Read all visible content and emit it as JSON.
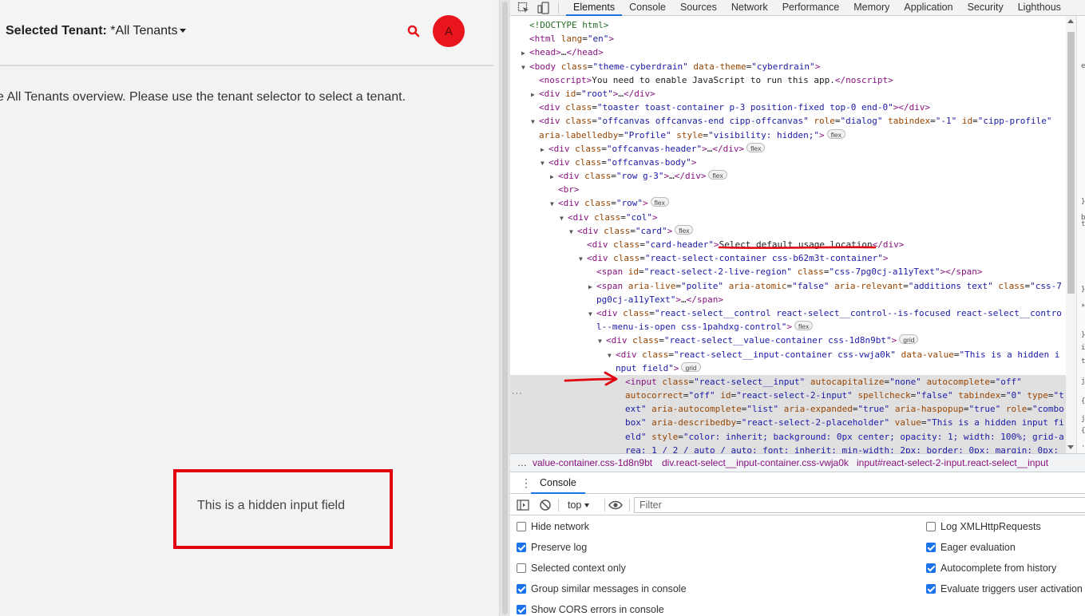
{
  "app": {
    "tenant_label": "Selected Tenant:",
    "tenant_value": "*All Tenants",
    "avatar_initial": "A",
    "overview_message": "e All Tenants overview. Please use the tenant selector to select a tenant.",
    "hidden_input_text": "This is a hidden input field"
  },
  "devtools": {
    "tabs": [
      "Elements",
      "Console",
      "Sources",
      "Network",
      "Performance",
      "Memory",
      "Application",
      "Security",
      "Lighthous"
    ],
    "active_tab": "Elements",
    "dom_lines": [
      {
        "indent": 0,
        "tri": "",
        "html": "<span class=\"cm\">&lt;!DOCTYPE html&gt;</span>"
      },
      {
        "indent": 0,
        "tri": "",
        "html": "<span class=\"tg\">&lt;html</span> <span class=\"an\">lang</span>=<span class=\"av\">\"en\"</span><span class=\"tg\">&gt;</span>"
      },
      {
        "indent": 0,
        "tri": "▶",
        "html": "<span class=\"tg\">&lt;head&gt;</span>…<span class=\"tg\">&lt;/head&gt;</span>"
      },
      {
        "indent": 0,
        "tri": "▼",
        "html": "<span class=\"tg\">&lt;body</span> <span class=\"an\">class</span>=<span class=\"av\">\"theme-cyberdrain\"</span> <span class=\"an\">data-theme</span>=<span class=\"av\">\"cyberdrain\"</span><span class=\"tg\">&gt;</span>"
      },
      {
        "indent": 1,
        "tri": "",
        "html": "<span class=\"tg\">&lt;noscript&gt;</span><span class=\"txt\">You need to enable JavaScript to run this app.</span><span class=\"tg\">&lt;/noscript&gt;</span>"
      },
      {
        "indent": 1,
        "tri": "▶",
        "html": "<span class=\"tg\">&lt;div</span> <span class=\"an\">id</span>=<span class=\"av\">\"root\"</span><span class=\"tg\">&gt;</span>…<span class=\"tg\">&lt;/div&gt;</span>"
      },
      {
        "indent": 1,
        "tri": "",
        "html": "<span class=\"tg\">&lt;div</span> <span class=\"an\">class</span>=<span class=\"av\">\"toaster toast-container p-3 position-fixed top-0 end-0\"</span><span class=\"tg\">&gt;&lt;/div&gt;</span>"
      },
      {
        "indent": 1,
        "tri": "▼",
        "html": "<span class=\"tg\">&lt;div</span> <span class=\"an\">class</span>=<span class=\"av\">\"offcanvas offcanvas-end cipp-offcanvas\"</span> <span class=\"an\">role</span>=<span class=\"av\">\"dialog\"</span> <span class=\"an\">tabindex</span>=<span class=\"av\">\"-1\"</span> <span class=\"an\">id</span>=<span class=\"av\">\"cipp-profile\"</span>"
      },
      {
        "indent": 1,
        "tri": "",
        "html": "<span class=\"an\">aria-labelledby</span>=<span class=\"av\">\"Profile\"</span> <span class=\"an\">style</span>=<span class=\"av\">\"visibility: hidden;\"</span><span class=\"tg\">&gt;</span><span class=\"badge\">flex</span>"
      },
      {
        "indent": 2,
        "tri": "▶",
        "html": "<span class=\"tg\">&lt;div</span> <span class=\"an\">class</span>=<span class=\"av\">\"offcanvas-header\"</span><span class=\"tg\">&gt;</span>…<span class=\"tg\">&lt;/div&gt;</span><span class=\"badge\">flex</span>"
      },
      {
        "indent": 2,
        "tri": "▼",
        "html": "<span class=\"tg\">&lt;div</span> <span class=\"an\">class</span>=<span class=\"av\">\"offcanvas-body\"</span><span class=\"tg\">&gt;</span>"
      },
      {
        "indent": 3,
        "tri": "▶",
        "html": "<span class=\"tg\">&lt;div</span> <span class=\"an\">class</span>=<span class=\"av\">\"row g-3\"</span><span class=\"tg\">&gt;</span>…<span class=\"tg\">&lt;/div&gt;</span><span class=\"badge\">flex</span>"
      },
      {
        "indent": 3,
        "tri": "",
        "html": "<span class=\"tg\">&lt;br&gt;</span>"
      },
      {
        "indent": 3,
        "tri": "▼",
        "html": "<span class=\"tg\">&lt;div</span> <span class=\"an\">class</span>=<span class=\"av\">\"row\"</span><span class=\"tg\">&gt;</span><span class=\"badge\">flex</span>"
      },
      {
        "indent": 4,
        "tri": "▼",
        "html": "<span class=\"tg\">&lt;div</span> <span class=\"an\">class</span>=<span class=\"av\">\"col\"</span><span class=\"tg\">&gt;</span>"
      },
      {
        "indent": 5,
        "tri": "▼",
        "html": "<span class=\"tg\">&lt;div</span> <span class=\"an\">class</span>=<span class=\"av\">\"card\"</span><span class=\"tg\">&gt;</span><span class=\"badge\">flex</span>"
      },
      {
        "indent": 6,
        "tri": "",
        "html": "<span class=\"tg\">&lt;div</span> <span class=\"an\">class</span>=<span class=\"av\">\"card-header\"</span><span class=\"tg\">&gt;</span><span class=\"txt\">Select default usage location</span><span class=\"tg\">&lt;/div&gt;</span>"
      },
      {
        "indent": 6,
        "tri": "▼",
        "html": "<span class=\"tg\">&lt;div</span> <span class=\"an\">class</span>=<span class=\"av\">\"react-select-container css-b62m3t-container\"</span><span class=\"tg\">&gt;</span>"
      },
      {
        "indent": 7,
        "tri": "",
        "html": "<span class=\"tg\">&lt;span</span> <span class=\"an\">id</span>=<span class=\"av\">\"react-select-2-live-region\"</span> <span class=\"an\">class</span>=<span class=\"av\">\"css-7pg0cj-a11yText\"</span><span class=\"tg\">&gt;&lt;/span&gt;</span>"
      },
      {
        "indent": 7,
        "tri": "▶",
        "html": "<span class=\"tg\">&lt;span</span> <span class=\"an\">aria-live</span>=<span class=\"av\">\"polite\"</span> <span class=\"an\">aria-atomic</span>=<span class=\"av\">\"false\"</span> <span class=\"an\">aria-relevant</span>=<span class=\"av\">\"additions text\"</span> <span class=\"an\">class</span>=<span class=\"av\">\"css-7</span>"
      },
      {
        "indent": 7,
        "tri": "",
        "html": "<span class=\"av\">pg0cj-a11yText\"</span><span class=\"tg\">&gt;</span>…<span class=\"tg\">&lt;/span&gt;</span>"
      },
      {
        "indent": 7,
        "tri": "▼",
        "html": "<span class=\"tg\">&lt;div</span> <span class=\"an\">class</span>=<span class=\"av\">\"react-select__control react-select__control--is-focused react-select__contro</span>"
      },
      {
        "indent": 7,
        "tri": "",
        "html": "<span class=\"av\">l--menu-is-open css-1pahdxg-control\"</span><span class=\"tg\">&gt;</span><span class=\"badge\">flex</span>"
      },
      {
        "indent": 8,
        "tri": "▼",
        "html": "<span class=\"tg\">&lt;div</span> <span class=\"an\">class</span>=<span class=\"av\">\"react-select__value-container css-1d8n9bt\"</span><span class=\"tg\">&gt;</span><span class=\"badge\">grid</span>"
      },
      {
        "indent": 9,
        "tri": "▼",
        "html": "<span class=\"tg\">&lt;div</span> <span class=\"an\">class</span>=<span class=\"av\">\"react-select__input-container css-vwja0k\"</span> <span class=\"an\">data-value</span>=<span class=\"av\">\"This is a hidden i</span>"
      },
      {
        "indent": 9,
        "tri": "",
        "html": "<span class=\"av\">nput field\"</span><span class=\"tg\">&gt;</span><span class=\"badge\">grid</span>"
      },
      {
        "indent": 10,
        "tri": "",
        "sel": true,
        "html": "<span class=\"tg\">&lt;input</span> <span class=\"an\">class</span>=<span class=\"av\">\"react-select__input\"</span> <span class=\"an\">autocapitalize</span>=<span class=\"av\">\"none\"</span> <span class=\"an\">autocomplete</span>=<span class=\"av\">\"off\"</span>"
      },
      {
        "indent": 10,
        "tri": "",
        "sel": true,
        "html": "<span class=\"an\">autocorrect</span>=<span class=\"av\">\"off\"</span> <span class=\"an\">id</span>=<span class=\"av\">\"react-select-2-input\"</span> <span class=\"an\">spellcheck</span>=<span class=\"av\">\"false\"</span> <span class=\"an\">tabindex</span>=<span class=\"av\">\"0\"</span> <span class=\"an\">type</span>=<span class=\"av\">\"t</span>"
      },
      {
        "indent": 10,
        "tri": "",
        "sel": true,
        "html": "<span class=\"av\">ext\"</span> <span class=\"an\">aria-autocomplete</span>=<span class=\"av\">\"list\"</span> <span class=\"an\">aria-expanded</span>=<span class=\"av\">\"true\"</span> <span class=\"an\">aria-haspopup</span>=<span class=\"av\">\"true\"</span> <span class=\"an\">role</span>=<span class=\"av\">\"combo</span>"
      },
      {
        "indent": 10,
        "tri": "",
        "sel": true,
        "html": "<span class=\"av\">box\"</span> <span class=\"an\">aria-describedby</span>=<span class=\"av\">\"react-select-2-placeholder\"</span> <span class=\"an\">value</span>=<span class=\"av\">\"This is a hidden input fi</span>"
      },
      {
        "indent": 10,
        "tri": "",
        "sel": true,
        "html": "<span class=\"av\">eld\"</span> <span class=\"an\">style</span>=<span class=\"av\">\"color: inherit; background: 0px center; opacity: 1; width: 100%; grid-a</span>"
      },
      {
        "indent": 10,
        "tri": "",
        "sel": true,
        "html": "<span class=\"av\">rea: 1 / 2 / auto / auto; font: inherit; min-width: 2px; border: 0px; margin: 0px;</span>"
      }
    ],
    "side_chars": [
      "e",
      "}",
      "b",
      "t",
      "}",
      "*",
      "}",
      "i",
      "t",
      "j",
      "{",
      "j",
      "{",
      "·"
    ],
    "ellipsis": "…",
    "breadcrumbs": [
      "value-container.css-1d8n9bt",
      "div.react-select__input-container.css-vwja0k",
      "input#react-select-2-input.react-select__input"
    ],
    "drawer_tab": "Console",
    "console": {
      "context": "top",
      "filter_placeholder": "Filter",
      "options_left": [
        {
          "label": "Hide network",
          "checked": false
        },
        {
          "label": "Preserve log",
          "checked": true
        },
        {
          "label": "Selected context only",
          "checked": false
        },
        {
          "label": "Group similar messages in console",
          "checked": true
        },
        {
          "label": "Show CORS errors in console",
          "checked": true
        }
      ],
      "options_right": [
        {
          "label": "Log XMLHttpRequests",
          "checked": false
        },
        {
          "label": "Eager evaluation",
          "checked": true
        },
        {
          "label": "Autocomplete from history",
          "checked": true
        },
        {
          "label": "Evaluate triggers user activation",
          "checked": true
        }
      ]
    }
  },
  "colors": {
    "annotation_red": "#e0000f",
    "avatar_red": "#e8151c",
    "devtools_blue": "#1a73e8"
  }
}
